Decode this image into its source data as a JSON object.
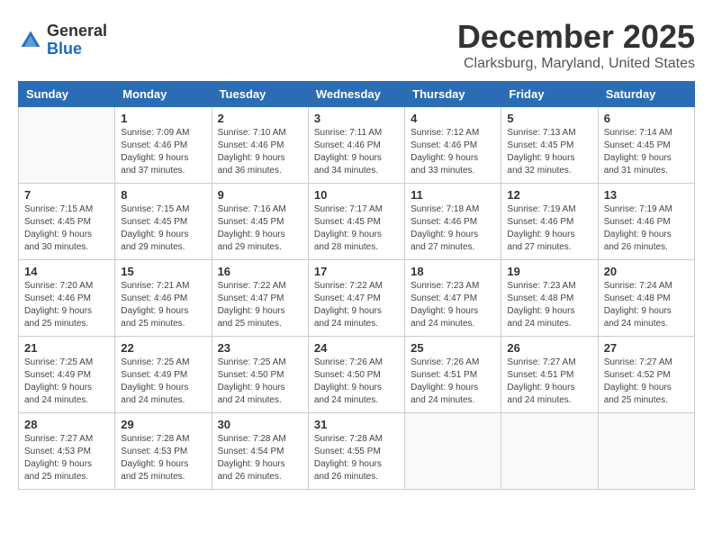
{
  "header": {
    "logo": {
      "general": "General",
      "blue": "Blue"
    },
    "title": "December 2025",
    "location": "Clarksburg, Maryland, United States"
  },
  "weekdays": [
    "Sunday",
    "Monday",
    "Tuesday",
    "Wednesday",
    "Thursday",
    "Friday",
    "Saturday"
  ],
  "weeks": [
    [
      {
        "day": "",
        "sunrise": "",
        "sunset": "",
        "daylight": ""
      },
      {
        "day": "1",
        "sunrise": "Sunrise: 7:09 AM",
        "sunset": "Sunset: 4:46 PM",
        "daylight": "Daylight: 9 hours and 37 minutes."
      },
      {
        "day": "2",
        "sunrise": "Sunrise: 7:10 AM",
        "sunset": "Sunset: 4:46 PM",
        "daylight": "Daylight: 9 hours and 36 minutes."
      },
      {
        "day": "3",
        "sunrise": "Sunrise: 7:11 AM",
        "sunset": "Sunset: 4:46 PM",
        "daylight": "Daylight: 9 hours and 34 minutes."
      },
      {
        "day": "4",
        "sunrise": "Sunrise: 7:12 AM",
        "sunset": "Sunset: 4:46 PM",
        "daylight": "Daylight: 9 hours and 33 minutes."
      },
      {
        "day": "5",
        "sunrise": "Sunrise: 7:13 AM",
        "sunset": "Sunset: 4:45 PM",
        "daylight": "Daylight: 9 hours and 32 minutes."
      },
      {
        "day": "6",
        "sunrise": "Sunrise: 7:14 AM",
        "sunset": "Sunset: 4:45 PM",
        "daylight": "Daylight: 9 hours and 31 minutes."
      }
    ],
    [
      {
        "day": "7",
        "sunrise": "Sunrise: 7:15 AM",
        "sunset": "Sunset: 4:45 PM",
        "daylight": "Daylight: 9 hours and 30 minutes."
      },
      {
        "day": "8",
        "sunrise": "Sunrise: 7:15 AM",
        "sunset": "Sunset: 4:45 PM",
        "daylight": "Daylight: 9 hours and 29 minutes."
      },
      {
        "day": "9",
        "sunrise": "Sunrise: 7:16 AM",
        "sunset": "Sunset: 4:45 PM",
        "daylight": "Daylight: 9 hours and 29 minutes."
      },
      {
        "day": "10",
        "sunrise": "Sunrise: 7:17 AM",
        "sunset": "Sunset: 4:45 PM",
        "daylight": "Daylight: 9 hours and 28 minutes."
      },
      {
        "day": "11",
        "sunrise": "Sunrise: 7:18 AM",
        "sunset": "Sunset: 4:46 PM",
        "daylight": "Daylight: 9 hours and 27 minutes."
      },
      {
        "day": "12",
        "sunrise": "Sunrise: 7:19 AM",
        "sunset": "Sunset: 4:46 PM",
        "daylight": "Daylight: 9 hours and 27 minutes."
      },
      {
        "day": "13",
        "sunrise": "Sunrise: 7:19 AM",
        "sunset": "Sunset: 4:46 PM",
        "daylight": "Daylight: 9 hours and 26 minutes."
      }
    ],
    [
      {
        "day": "14",
        "sunrise": "Sunrise: 7:20 AM",
        "sunset": "Sunset: 4:46 PM",
        "daylight": "Daylight: 9 hours and 25 minutes."
      },
      {
        "day": "15",
        "sunrise": "Sunrise: 7:21 AM",
        "sunset": "Sunset: 4:46 PM",
        "daylight": "Daylight: 9 hours and 25 minutes."
      },
      {
        "day": "16",
        "sunrise": "Sunrise: 7:22 AM",
        "sunset": "Sunset: 4:47 PM",
        "daylight": "Daylight: 9 hours and 25 minutes."
      },
      {
        "day": "17",
        "sunrise": "Sunrise: 7:22 AM",
        "sunset": "Sunset: 4:47 PM",
        "daylight": "Daylight: 9 hours and 24 minutes."
      },
      {
        "day": "18",
        "sunrise": "Sunrise: 7:23 AM",
        "sunset": "Sunset: 4:47 PM",
        "daylight": "Daylight: 9 hours and 24 minutes."
      },
      {
        "day": "19",
        "sunrise": "Sunrise: 7:23 AM",
        "sunset": "Sunset: 4:48 PM",
        "daylight": "Daylight: 9 hours and 24 minutes."
      },
      {
        "day": "20",
        "sunrise": "Sunrise: 7:24 AM",
        "sunset": "Sunset: 4:48 PM",
        "daylight": "Daylight: 9 hours and 24 minutes."
      }
    ],
    [
      {
        "day": "21",
        "sunrise": "Sunrise: 7:25 AM",
        "sunset": "Sunset: 4:49 PM",
        "daylight": "Daylight: 9 hours and 24 minutes."
      },
      {
        "day": "22",
        "sunrise": "Sunrise: 7:25 AM",
        "sunset": "Sunset: 4:49 PM",
        "daylight": "Daylight: 9 hours and 24 minutes."
      },
      {
        "day": "23",
        "sunrise": "Sunrise: 7:25 AM",
        "sunset": "Sunset: 4:50 PM",
        "daylight": "Daylight: 9 hours and 24 minutes."
      },
      {
        "day": "24",
        "sunrise": "Sunrise: 7:26 AM",
        "sunset": "Sunset: 4:50 PM",
        "daylight": "Daylight: 9 hours and 24 minutes."
      },
      {
        "day": "25",
        "sunrise": "Sunrise: 7:26 AM",
        "sunset": "Sunset: 4:51 PM",
        "daylight": "Daylight: 9 hours and 24 minutes."
      },
      {
        "day": "26",
        "sunrise": "Sunrise: 7:27 AM",
        "sunset": "Sunset: 4:51 PM",
        "daylight": "Daylight: 9 hours and 24 minutes."
      },
      {
        "day": "27",
        "sunrise": "Sunrise: 7:27 AM",
        "sunset": "Sunset: 4:52 PM",
        "daylight": "Daylight: 9 hours and 25 minutes."
      }
    ],
    [
      {
        "day": "28",
        "sunrise": "Sunrise: 7:27 AM",
        "sunset": "Sunset: 4:53 PM",
        "daylight": "Daylight: 9 hours and 25 minutes."
      },
      {
        "day": "29",
        "sunrise": "Sunrise: 7:28 AM",
        "sunset": "Sunset: 4:53 PM",
        "daylight": "Daylight: 9 hours and 25 minutes."
      },
      {
        "day": "30",
        "sunrise": "Sunrise: 7:28 AM",
        "sunset": "Sunset: 4:54 PM",
        "daylight": "Daylight: 9 hours and 26 minutes."
      },
      {
        "day": "31",
        "sunrise": "Sunrise: 7:28 AM",
        "sunset": "Sunset: 4:55 PM",
        "daylight": "Daylight: 9 hours and 26 minutes."
      },
      {
        "day": "",
        "sunrise": "",
        "sunset": "",
        "daylight": ""
      },
      {
        "day": "",
        "sunrise": "",
        "sunset": "",
        "daylight": ""
      },
      {
        "day": "",
        "sunrise": "",
        "sunset": "",
        "daylight": ""
      }
    ]
  ]
}
